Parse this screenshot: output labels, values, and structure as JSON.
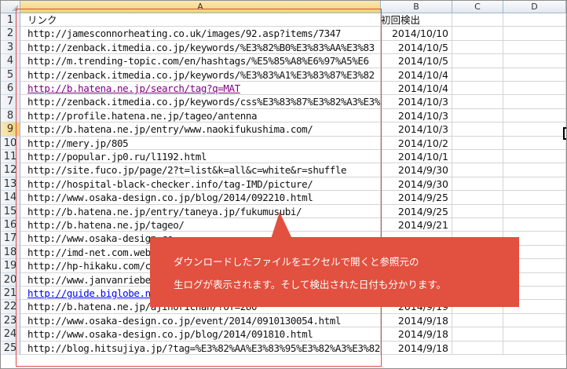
{
  "columns": [
    "A",
    "B",
    "C",
    "D"
  ],
  "header_row": {
    "row_num": "1",
    "link_label": "リンク",
    "date_label": "初回検出"
  },
  "rows": [
    {
      "n": "2",
      "url": "http://jamesconnorheating.co.uk/images/92.asp?items/7347",
      "date": "2014/10/10"
    },
    {
      "n": "3",
      "url": "http://zenback.itmedia.co.jp/keywords/%E3%82%B0%E3%83%AA%E3%83",
      "date": "2014/10/5"
    },
    {
      "n": "4",
      "url": "http://m.trending-topic.com/en/hashtags/%E5%85%A8%E6%97%A5%E6",
      "date": "2014/10/5"
    },
    {
      "n": "5",
      "url": "http://zenback.itmedia.co.jp/keywords/%E3%83%A1%E3%83%87%E3%82",
      "date": "2014/10/4"
    },
    {
      "n": "6",
      "url": "http://b.hatena.ne.jp/search/tag?q=MAT",
      "date": "2014/10/4",
      "style": "visited"
    },
    {
      "n": "7",
      "url": "http://zenback.itmedia.co.jp/keywords/css%E3%83%87%E3%82%A3%E3%",
      "date": "2014/10/3"
    },
    {
      "n": "8",
      "url": "http://profile.hatena.ne.jp/tageo/antenna",
      "date": "2014/10/3"
    },
    {
      "n": "9",
      "url": "http://b.hatena.ne.jp/entry/www.naokifukushima.com/",
      "date": "2014/10/3",
      "selected": true
    },
    {
      "n": "10",
      "url": "http://mery.jp/805",
      "date": "2014/10/2"
    },
    {
      "n": "11",
      "url": "http://popular.jp0.ru/l1192.html",
      "date": "2014/10/1"
    },
    {
      "n": "12",
      "url": "http://site.fuco.jp/page/2?t=list&k=all&c=white&r=shuffle",
      "date": "2014/9/30"
    },
    {
      "n": "13",
      "url": "http://hospital-black-checker.info/tag-IMD/picture/",
      "date": "2014/9/30"
    },
    {
      "n": "14",
      "url": "http://www.osaka-design.co.jp/blog/2014/092210.html",
      "date": "2014/9/25"
    },
    {
      "n": "15",
      "url": "http://b.hatena.ne.jp/entry/taneya.jp/fukumusubi/",
      "date": "2014/9/25"
    },
    {
      "n": "16",
      "url": "http://b.hatena.ne.jp/tageo/",
      "date": "2014/9/21"
    },
    {
      "n": "17",
      "url": "http://www.osaka-design.co",
      "date": ""
    },
    {
      "n": "18",
      "url": "http://imd-net.com.webs",
      "date": ""
    },
    {
      "n": "19",
      "url": "http://hp-hikaku.com/co",
      "date": ""
    },
    {
      "n": "20",
      "url": "http://www.janvanriebee",
      "date": ""
    },
    {
      "n": "21",
      "url": "http://guide.biglobe.ne.jp",
      "date": "",
      "style": "link"
    },
    {
      "n": "22",
      "url": "http://b.hatena.ne.jp/ajinorichan/?of=280",
      "date": "2014/9/19"
    },
    {
      "n": "23",
      "url": "http://www.osaka-design.co.jp/event/2014/0910130054.html",
      "date": "2014/9/18"
    },
    {
      "n": "24",
      "url": "http://www.osaka-design.co.jp/blog/2014/091810.html",
      "date": "2014/9/18"
    },
    {
      "n": "25",
      "url": "http://blog.hitsujiya.jp/?tag=%E3%82%AA%E3%83%95%E3%82%A3%E3%82",
      "date": "2014/9/18"
    }
  ],
  "callout": {
    "line1": "ダウンロードしたファイルをエクセルで開くと参照元の",
    "line2": "生ログが表示されます。そして検出された日付も分かります。"
  },
  "colors": {
    "callout": "#e2503f",
    "highlight_box": "#e6474b",
    "visited_link": "#800080",
    "link": "#0000ff"
  }
}
